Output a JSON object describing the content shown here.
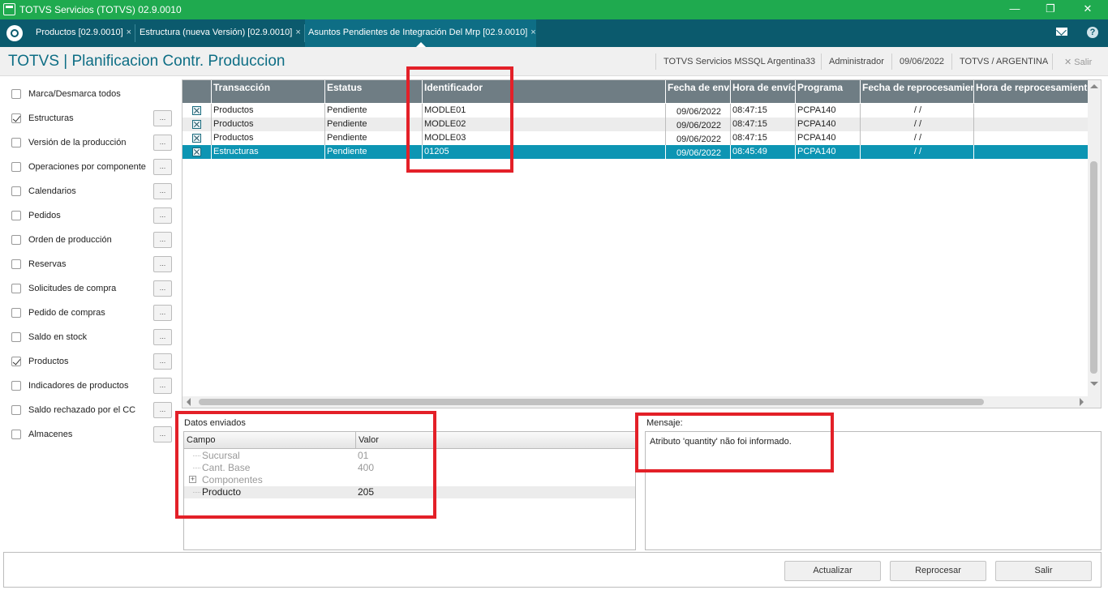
{
  "window": {
    "title": "TOTVS Servicios (TOTVS) 02.9.0010",
    "minimize": "—",
    "restore": "❐",
    "close": "✕"
  },
  "tabs": [
    {
      "label": "Productos [02.9.0010]",
      "close": "×"
    },
    {
      "label": "Estructura (nueva Versión) [02.9.0010]",
      "close": "×"
    },
    {
      "label": "Asuntos Pendientes de Integración Del Mrp [02.9.0010]",
      "close": "×"
    }
  ],
  "header": {
    "title": "TOTVS | Planificacion Contr. Produccion",
    "server": "TOTVS Servicios MSSQL Argentina33",
    "user": "Administrador",
    "date": "09/06/2022",
    "company": "TOTVS / ARGENTINA",
    "exit_label": "✕ Salir",
    "help": "?"
  },
  "filters": [
    {
      "label": "Marca/Desmarca todos",
      "checked": false,
      "has_button": false
    },
    {
      "label": "Estructuras",
      "checked": true,
      "has_button": true
    },
    {
      "label": "Versión de la producción",
      "checked": false,
      "has_button": true
    },
    {
      "label": "Operaciones por componente",
      "checked": false,
      "has_button": true
    },
    {
      "label": "Calendarios",
      "checked": false,
      "has_button": true
    },
    {
      "label": "Pedidos",
      "checked": false,
      "has_button": true
    },
    {
      "label": "Orden de producción",
      "checked": false,
      "has_button": true
    },
    {
      "label": "Reservas",
      "checked": false,
      "has_button": true
    },
    {
      "label": "Solicitudes de compra",
      "checked": false,
      "has_button": true
    },
    {
      "label": "Pedido de compras",
      "checked": false,
      "has_button": true
    },
    {
      "label": "Saldo en stock",
      "checked": false,
      "has_button": true
    },
    {
      "label": "Productos",
      "checked": true,
      "has_button": true
    },
    {
      "label": "Indicadores de productos",
      "checked": false,
      "has_button": true
    },
    {
      "label": "Saldo rechazado por el CC",
      "checked": false,
      "has_button": true
    },
    {
      "label": "Almacenes",
      "checked": false,
      "has_button": true
    }
  ],
  "dots_label": "...",
  "grid": {
    "columns": [
      "",
      "Transacción",
      "Estatus",
      "Identificador",
      "Fecha de envío",
      "Hora de envío",
      "Programa",
      "Fecha de reprocesamiento",
      "Hora de reprocesamiento"
    ],
    "rows": [
      {
        "transaccion": "Productos",
        "estatus": "Pendiente",
        "identificador": "MODLE01",
        "fecha": "09/06/2022",
        "hora": "08:47:15",
        "programa": "PCPA140",
        "fecha_rep": "/ /",
        "hora_rep": ""
      },
      {
        "transaccion": "Productos",
        "estatus": "Pendiente",
        "identificador": "MODLE02",
        "fecha": "09/06/2022",
        "hora": "08:47:15",
        "programa": "PCPA140",
        "fecha_rep": "/ /",
        "hora_rep": ""
      },
      {
        "transaccion": "Productos",
        "estatus": "Pendiente",
        "identificador": "MODLE03",
        "fecha": "09/06/2022",
        "hora": "08:47:15",
        "programa": "PCPA140",
        "fecha_rep": "/ /",
        "hora_rep": ""
      },
      {
        "transaccion": "Estructuras",
        "estatus": "Pendiente",
        "identificador": "01205",
        "fecha": "09/06/2022",
        "hora": "08:45:49",
        "programa": "PCPA140",
        "fecha_rep": "/ /",
        "hora_rep": ""
      }
    ]
  },
  "datos": {
    "label": "Datos enviados",
    "col_campo": "Campo",
    "col_valor": "Valor",
    "items": [
      {
        "campo": "Sucursal",
        "valor": "01"
      },
      {
        "campo": "Cant. Base",
        "valor": "400"
      },
      {
        "campo": "Componentes",
        "valor": ""
      },
      {
        "campo": "Producto",
        "valor": "205"
      }
    ]
  },
  "mensaje": {
    "label": "Mensaje:",
    "text": "Atributo 'quantity' não foi informado."
  },
  "buttons": {
    "actualizar": "Actualizar",
    "reprocesar": "Reprocesar",
    "salir": "Salir"
  },
  "colors": {
    "titlebar": "#1faa4f",
    "tabbar": "#0b5a6d",
    "accent": "#0e6e85",
    "selected_row": "#0d95b3",
    "highlight_box": "#e32028"
  }
}
